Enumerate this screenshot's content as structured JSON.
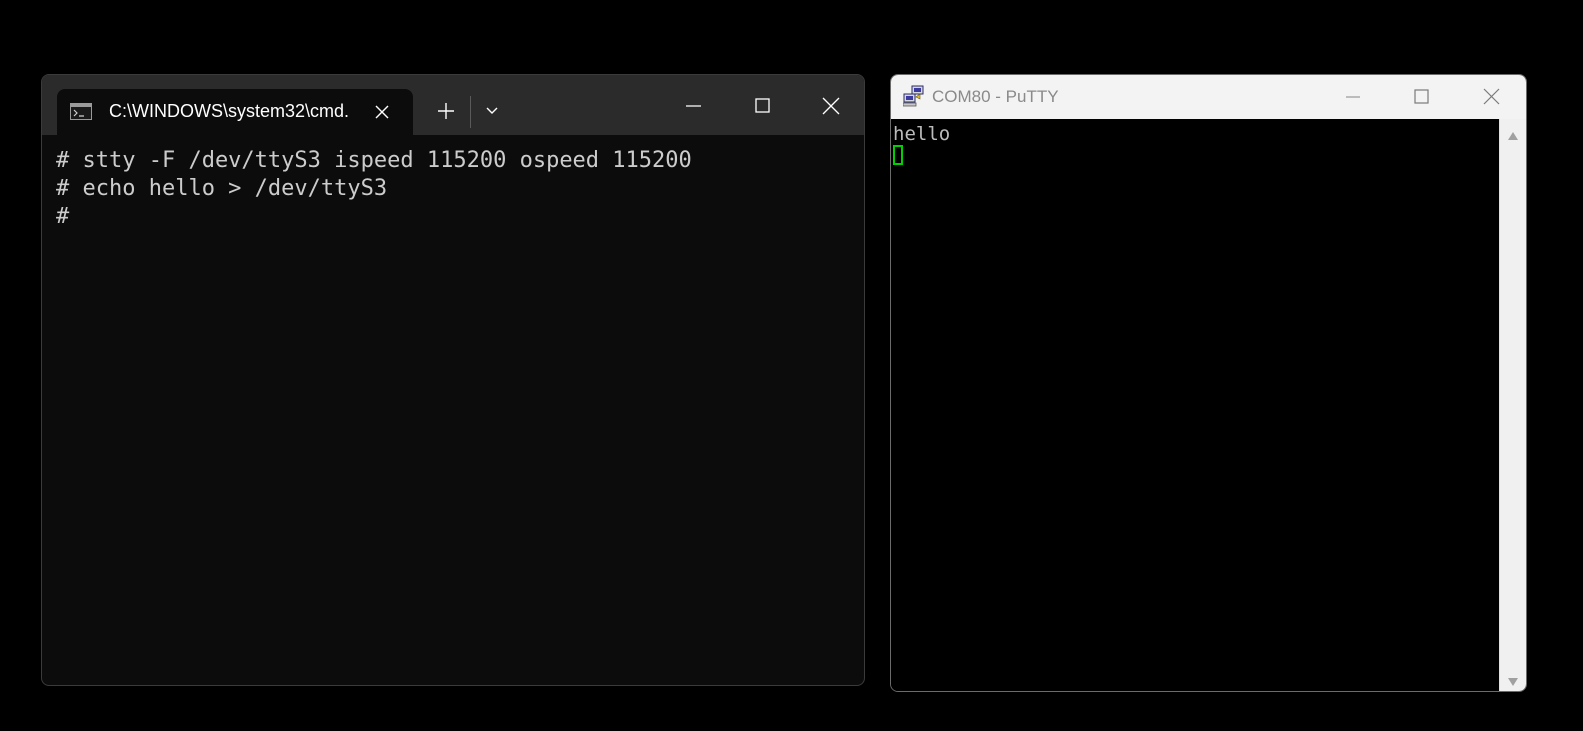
{
  "terminal": {
    "tab_title": "C:\\WINDOWS\\system32\\cmd.",
    "tab_icon": "cmd-prompt-icon",
    "lines": [
      "# stty -F /dev/ttyS3 ispeed 115200 ospeed 115200",
      "# echo hello > /dev/ttyS3",
      "#"
    ]
  },
  "putty": {
    "title": "COM80 - PuTTY",
    "icon": "putty-computers-icon",
    "output": [
      "hello"
    ],
    "cursor_color": "#00d000"
  },
  "colors": {
    "desktop_bg": "#000000",
    "terminal_bg": "#0c0c0c",
    "terminal_titlebar": "#2b2b2b",
    "terminal_text": "#cccccc",
    "putty_titlebar": "#f3f3f3",
    "putty_text": "#bbbbbb"
  }
}
